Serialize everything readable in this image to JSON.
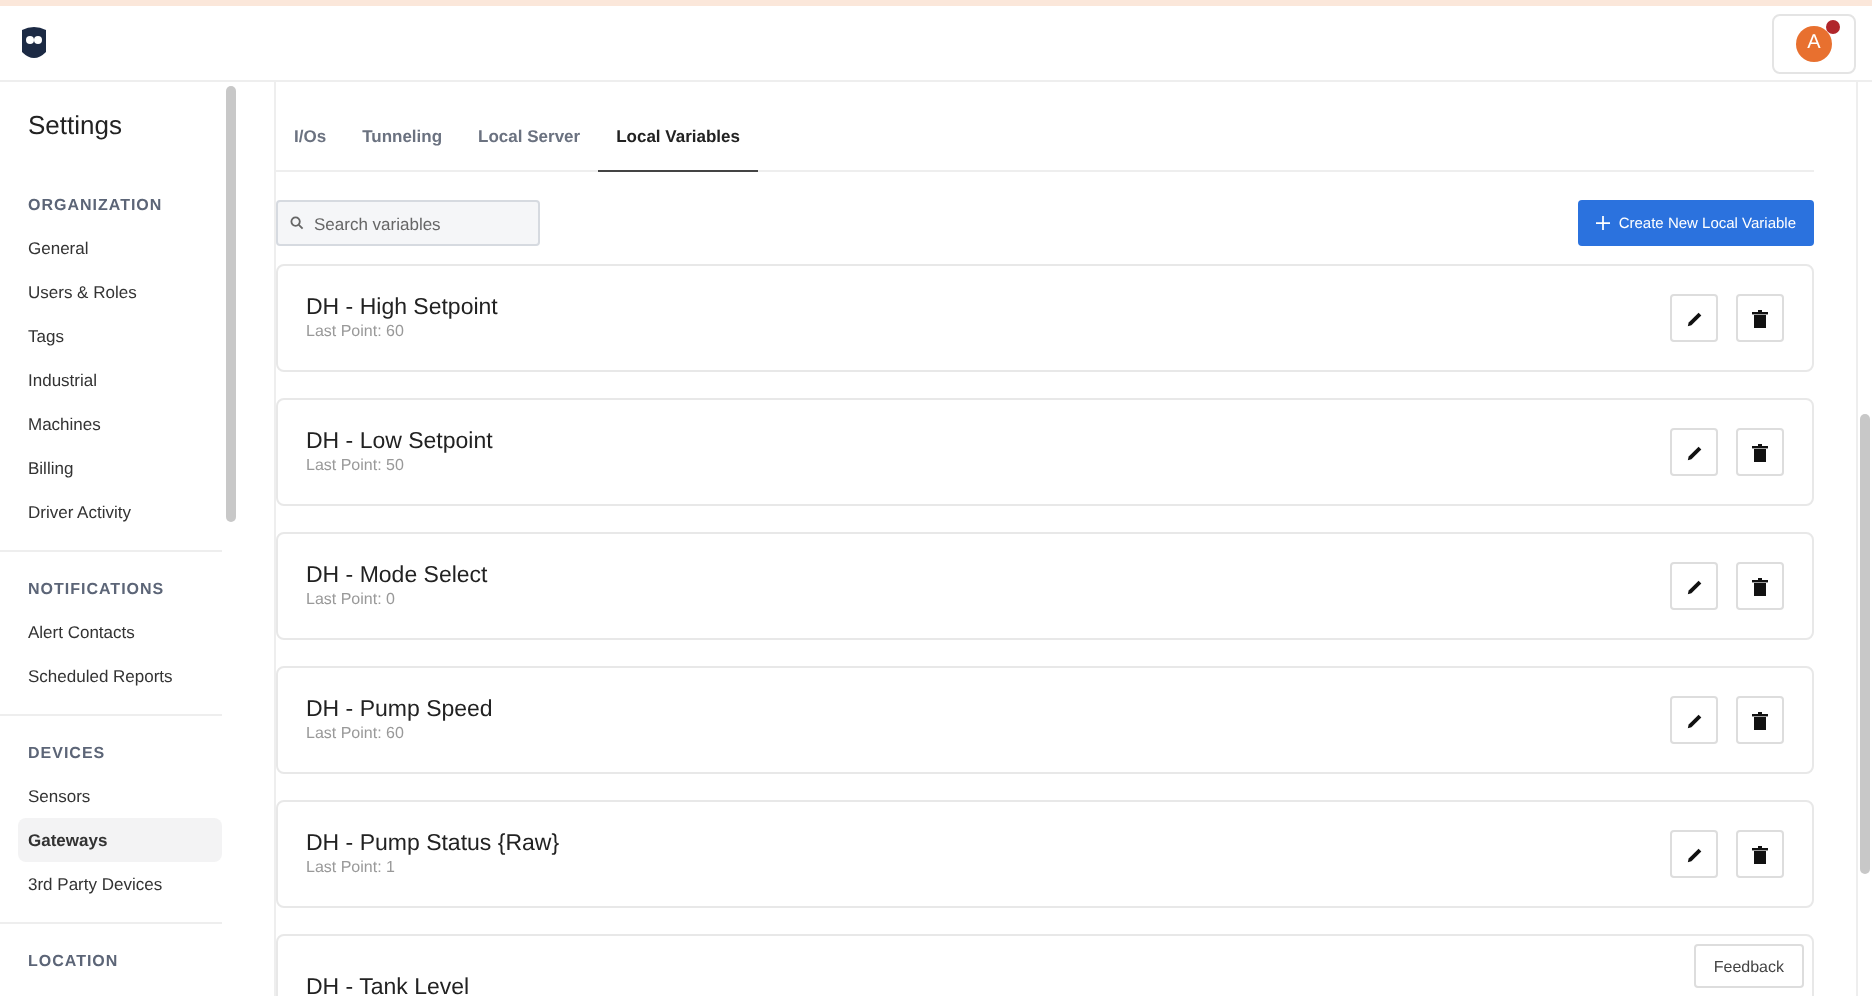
{
  "header": {
    "avatar": {
      "initial": "A",
      "notification": true
    }
  },
  "sidebar": {
    "title": "Settings",
    "sections": [
      {
        "heading": "ORGANIZATION",
        "items": [
          {
            "label": "General",
            "selected": false
          },
          {
            "label": "Users & Roles",
            "selected": false
          },
          {
            "label": "Tags",
            "selected": false
          },
          {
            "label": "Industrial",
            "selected": false
          },
          {
            "label": "Machines",
            "selected": false
          },
          {
            "label": "Billing",
            "selected": false
          },
          {
            "label": "Driver Activity",
            "selected": false
          }
        ]
      },
      {
        "heading": "NOTIFICATIONS",
        "items": [
          {
            "label": "Alert Contacts",
            "selected": false
          },
          {
            "label": "Scheduled Reports",
            "selected": false
          }
        ]
      },
      {
        "heading": "DEVICES",
        "items": [
          {
            "label": "Sensors",
            "selected": false
          },
          {
            "label": "Gateways",
            "selected": true
          },
          {
            "label": "3rd Party Devices",
            "selected": false
          }
        ]
      },
      {
        "heading": "LOCATION"
      }
    ]
  },
  "tabs": [
    {
      "label": "I/Os",
      "selected": false
    },
    {
      "label": "Tunneling",
      "selected": false
    },
    {
      "label": "Local Server",
      "selected": false
    },
    {
      "label": "Local Variables",
      "selected": true
    }
  ],
  "search": {
    "placeholder": "Search variables"
  },
  "create_button": {
    "label": "Create New Local Variable"
  },
  "variables": [
    {
      "name": "DH - High Setpoint",
      "last_point": "Last Point: 60"
    },
    {
      "name": "DH - Low Setpoint",
      "last_point": "Last Point: 50"
    },
    {
      "name": "DH - Mode Select",
      "last_point": "Last Point: 0"
    },
    {
      "name": "DH - Pump Speed",
      "last_point": "Last Point: 60"
    },
    {
      "name": "DH - Pump Status {Raw}",
      "last_point": "Last Point: 1"
    },
    {
      "name": "DH - Tank Level"
    }
  ],
  "feedback_button": {
    "label": "Feedback"
  }
}
